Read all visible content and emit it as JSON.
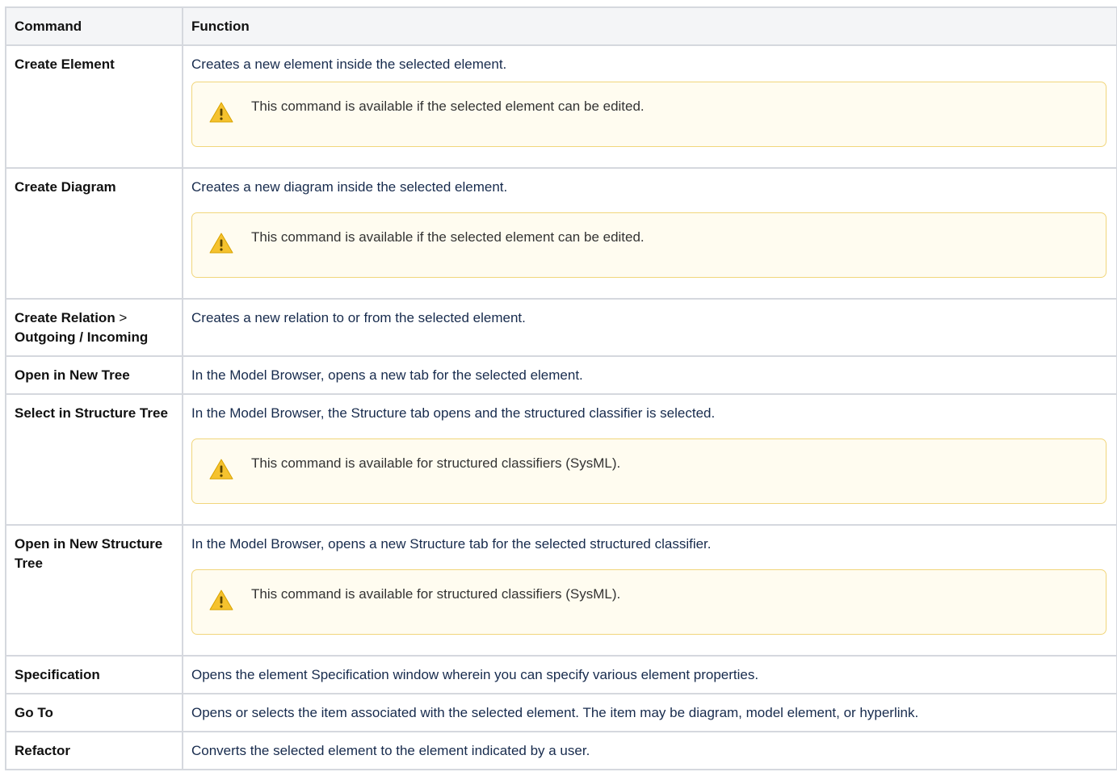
{
  "table": {
    "headers": [
      "Command",
      "Function"
    ],
    "rows": [
      {
        "command": "Create Element",
        "function": "Creates a new element inside the selected element.",
        "note": "This command is available if the selected element can be edited."
      },
      {
        "command": "Create Diagram",
        "function": "Creates a new diagram inside the selected element.",
        "note": "This command is available if the selected element can be edited."
      },
      {
        "command": "Create Relation",
        "command_sep": " > ",
        "command_line2": "Outgoing / Incoming",
        "function": "Creates a new relation to or from the selected element."
      },
      {
        "command": "Open in New Tree",
        "function": "In the Model Browser, opens a new tab for the selected element."
      },
      {
        "command": "Select in Structure Tree",
        "function": "In the Model Browser, the Structure tab opens and the structured classifier is selected.",
        "note": "This command is available for structured classifiers (SysML)."
      },
      {
        "command": "Open in New Structure Tree",
        "function": "In the Model Browser, opens a new Structure tab for the selected structured classifier.",
        "note": "This command is available for structured classifiers (SysML)."
      },
      {
        "command": "Specification",
        "function": "Opens the element Specification window wherein you can specify various element properties."
      },
      {
        "command": "Go To",
        "function": "Opens or selects the item associated with the selected element. The item may be diagram, model element, or hyperlink."
      },
      {
        "command": "Refactor",
        "function": "Converts the selected element to the element indicated by a user."
      }
    ]
  },
  "icons": {
    "note_icon": "warning-icon"
  },
  "colors": {
    "border": "#d5d8de",
    "header_bg": "#f4f5f7",
    "note_border": "#f1d67c",
    "note_bg": "#fffcf0",
    "warning_fill": "#f5c22e"
  }
}
